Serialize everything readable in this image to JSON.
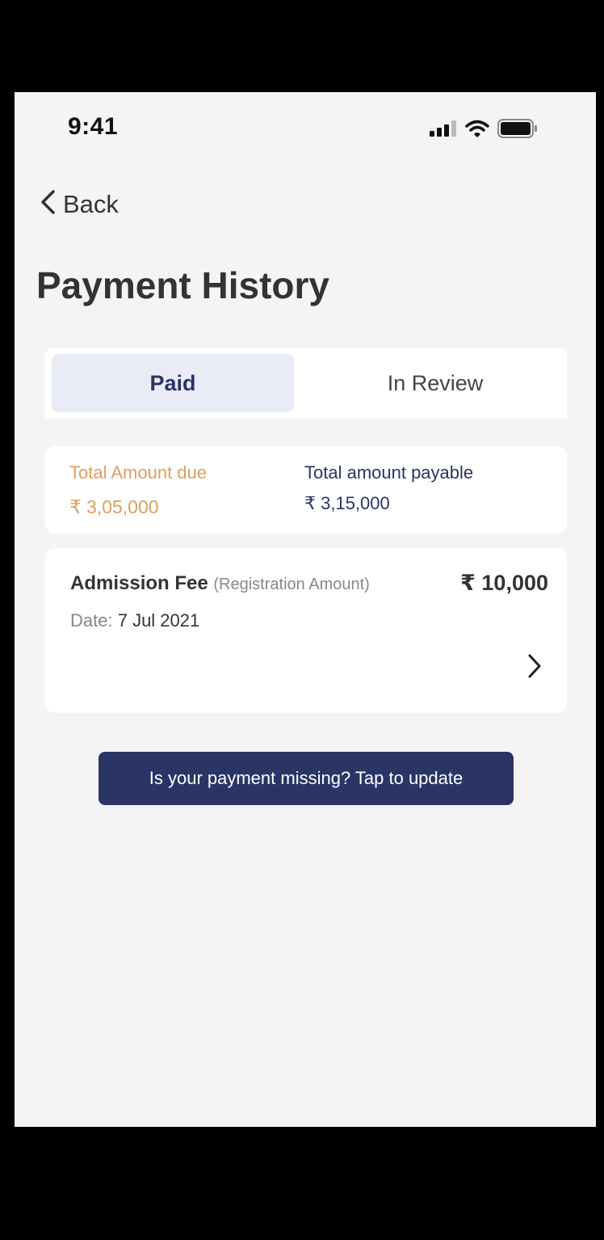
{
  "status_bar": {
    "time": "9:41",
    "icons": [
      "signal-icon",
      "wifi-icon",
      "battery-icon"
    ]
  },
  "nav": {
    "back_label": "Back",
    "back_icon": "chevron-left-icon"
  },
  "page": {
    "title": "Payment History"
  },
  "tabs": [
    {
      "label": "Paid",
      "active": true
    },
    {
      "label": "In Review",
      "active": false
    }
  ],
  "summary": {
    "due_label": "Total Amount due",
    "due_value": "₹ 3,05,000",
    "payable_label": "Total amount payable",
    "payable_value": "₹ 3,15,000"
  },
  "payments": [
    {
      "title": "Admission Fee",
      "subtitle": "(Registration Amount)",
      "amount": "₹ 10,000",
      "date_label": "Date:",
      "date_value": "7 Jul 2021",
      "icon": "chevron-right-icon"
    }
  ],
  "cta": {
    "label": "Is your payment missing? Tap to update"
  },
  "colors": {
    "background": "#f4f4f4",
    "primary": "#2a3566",
    "accent_due": "#dda05e",
    "tab_active_bg": "#e9ecf7",
    "text_dark": "#333333",
    "text_muted": "#888888"
  }
}
